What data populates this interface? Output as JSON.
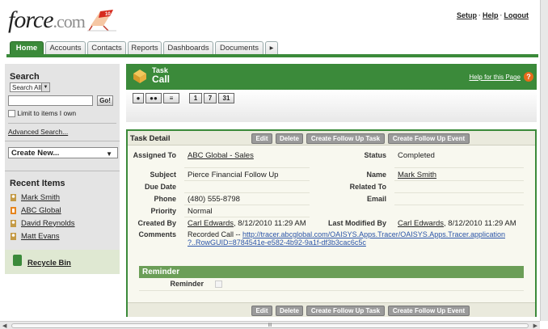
{
  "header": {
    "logo_main": "force",
    "logo_suffix": ".com",
    "links": [
      "Setup",
      "Help",
      "Logout"
    ],
    "separator": "·"
  },
  "tabs": [
    {
      "label": "Home",
      "active": true
    },
    {
      "label": "Accounts",
      "active": false
    },
    {
      "label": "Contacts",
      "active": false
    },
    {
      "label": "Reports",
      "active": false
    },
    {
      "label": "Dashboards",
      "active": false
    },
    {
      "label": "Documents",
      "active": false
    },
    {
      "label": "▸",
      "active": false
    }
  ],
  "sidebar": {
    "search_title": "Search",
    "search_scope": "Search All",
    "go_label": "Go!",
    "limit_label": "Limit to items I own",
    "advanced_label": "Advanced Search...",
    "create_new_label": "Create New...",
    "recent_title": "Recent Items",
    "recent_items": [
      {
        "label": "Mark Smith",
        "icon": "contact-icon"
      },
      {
        "label": "ABC Global",
        "icon": "account-icon"
      },
      {
        "label": "David Reynolds",
        "icon": "contact-icon"
      },
      {
        "label": "Matt Evans",
        "icon": "contact-icon"
      }
    ],
    "recycle_label": "Recycle Bin"
  },
  "main": {
    "object_type": "Task",
    "record_name": "Call",
    "help_label": "Help for this Page",
    "help_icon": "?",
    "view_buttons": [
      "1",
      "7",
      "31"
    ]
  },
  "detail": {
    "title": "Task Detail",
    "buttons": [
      "Edit",
      "Delete",
      "Create Follow Up Task",
      "Create Follow Up Event"
    ],
    "fields": {
      "assigned_to_label": "Assigned To",
      "assigned_to_value": "ABC Global - Sales",
      "status_label": "Status",
      "status_value": "Completed",
      "subject_label": "Subject",
      "subject_value": "Pierce Financial Follow Up",
      "name_label": "Name",
      "name_value": "Mark Smith",
      "due_date_label": "Due Date",
      "due_date_value": "",
      "related_to_label": "Related To",
      "related_to_value": "",
      "phone_label": "Phone",
      "phone_value": "(480) 555-8798",
      "email_label": "Email",
      "email_value": "",
      "priority_label": "Priority",
      "priority_value": "Normal",
      "created_by_label": "Created By",
      "created_by_user": "Carl Edwards",
      "created_by_date": ", 8/12/2010 11:29 AM",
      "modified_by_label": "Last Modified By",
      "modified_by_user": "Carl Edwards",
      "modified_by_date": ", 8/12/2010 11:29 AM",
      "comments_label": "Comments",
      "comments_prefix": "Recorded Call -- ",
      "comments_link1": "http://tracer.abcglobal.com/OAISYS.Apps.Tracer/OAISYS.Apps.Tracer.application",
      "comments_link2": "?..RowGUID=8784541e-e582-4b92-9a1f-df3b3cac6c5c"
    },
    "reminder_title": "Reminder",
    "reminder_label": "Reminder"
  },
  "scroll": {
    "thumb_label": "III"
  },
  "colors": {
    "brand_green": "#3b8a3a",
    "help_orange": "#e76a1a",
    "button_gray": "#9a9a9a"
  }
}
